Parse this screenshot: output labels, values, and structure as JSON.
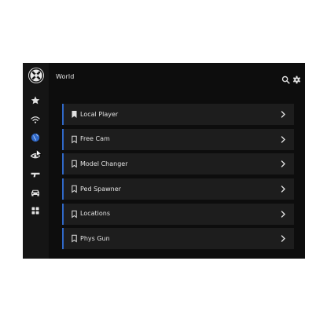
{
  "colors": {
    "accent": "#2f68c8",
    "panel_bg": "#0d0d0d",
    "sidebar_bg": "#151515",
    "item_bg": "#1d1d1d",
    "text": "#e3e3e3"
  },
  "sidebar": {
    "logo_icon": "x-circle-logo-icon",
    "items": [
      {
        "icon": "star-icon",
        "active": false
      },
      {
        "icon": "wifi-icon",
        "active": false
      },
      {
        "icon": "globe-icon",
        "active": true
      },
      {
        "icon": "eye-icon",
        "active": false
      },
      {
        "icon": "gun-icon",
        "active": false
      },
      {
        "icon": "car-icon",
        "active": false
      },
      {
        "icon": "grid-icon",
        "active": false
      }
    ]
  },
  "header": {
    "title": "World",
    "search_icon": "search-icon",
    "settings_icon": "gear-icon"
  },
  "menu": {
    "items": [
      {
        "label": "Local Player",
        "bookmark": "filled"
      },
      {
        "label": "Free Cam",
        "bookmark": "outline"
      },
      {
        "label": "Model Changer",
        "bookmark": "outline"
      },
      {
        "label": "Ped Spawner",
        "bookmark": "outline"
      },
      {
        "label": "Locations",
        "bookmark": "outline"
      },
      {
        "label": "Phys Gun",
        "bookmark": "outline"
      }
    ]
  }
}
